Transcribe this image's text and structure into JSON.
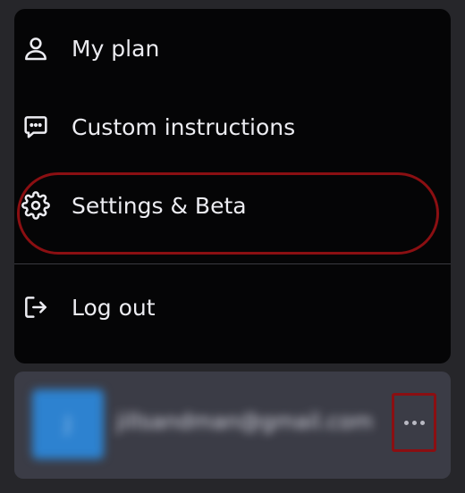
{
  "menu": {
    "items": [
      {
        "label": "My plan",
        "icon": "user-icon"
      },
      {
        "label": "Custom instructions",
        "icon": "message-square-icon"
      },
      {
        "label": "Settings & Beta",
        "icon": "gear-icon"
      },
      {
        "label": "Log out",
        "icon": "log-out-icon"
      }
    ]
  },
  "account": {
    "avatar_initial": "J",
    "email": "jillsandman@gmail.com",
    "more_icon": "ellipsis-icon"
  },
  "colors": {
    "page_background": "#26262a",
    "menu_background": "#050506",
    "account_background": "#3b3c46",
    "avatar": "#2d82d0",
    "highlight": "#8b0f12",
    "text": "#ececf1"
  }
}
